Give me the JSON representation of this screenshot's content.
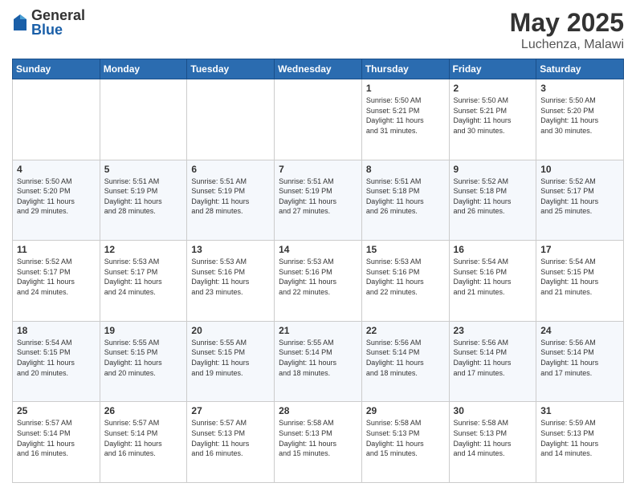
{
  "header": {
    "logo": {
      "general": "General",
      "blue": "Blue"
    },
    "title": "May 2025",
    "location": "Luchenza, Malawi"
  },
  "days_of_week": [
    "Sunday",
    "Monday",
    "Tuesday",
    "Wednesday",
    "Thursday",
    "Friday",
    "Saturday"
  ],
  "weeks": [
    [
      {
        "day": "",
        "info": ""
      },
      {
        "day": "",
        "info": ""
      },
      {
        "day": "",
        "info": ""
      },
      {
        "day": "",
        "info": ""
      },
      {
        "day": "1",
        "info": "Sunrise: 5:50 AM\nSunset: 5:21 PM\nDaylight: 11 hours\nand 31 minutes."
      },
      {
        "day": "2",
        "info": "Sunrise: 5:50 AM\nSunset: 5:21 PM\nDaylight: 11 hours\nand 30 minutes."
      },
      {
        "day": "3",
        "info": "Sunrise: 5:50 AM\nSunset: 5:20 PM\nDaylight: 11 hours\nand 30 minutes."
      }
    ],
    [
      {
        "day": "4",
        "info": "Sunrise: 5:50 AM\nSunset: 5:20 PM\nDaylight: 11 hours\nand 29 minutes."
      },
      {
        "day": "5",
        "info": "Sunrise: 5:51 AM\nSunset: 5:19 PM\nDaylight: 11 hours\nand 28 minutes."
      },
      {
        "day": "6",
        "info": "Sunrise: 5:51 AM\nSunset: 5:19 PM\nDaylight: 11 hours\nand 28 minutes."
      },
      {
        "day": "7",
        "info": "Sunrise: 5:51 AM\nSunset: 5:19 PM\nDaylight: 11 hours\nand 27 minutes."
      },
      {
        "day": "8",
        "info": "Sunrise: 5:51 AM\nSunset: 5:18 PM\nDaylight: 11 hours\nand 26 minutes."
      },
      {
        "day": "9",
        "info": "Sunrise: 5:52 AM\nSunset: 5:18 PM\nDaylight: 11 hours\nand 26 minutes."
      },
      {
        "day": "10",
        "info": "Sunrise: 5:52 AM\nSunset: 5:17 PM\nDaylight: 11 hours\nand 25 minutes."
      }
    ],
    [
      {
        "day": "11",
        "info": "Sunrise: 5:52 AM\nSunset: 5:17 PM\nDaylight: 11 hours\nand 24 minutes."
      },
      {
        "day": "12",
        "info": "Sunrise: 5:53 AM\nSunset: 5:17 PM\nDaylight: 11 hours\nand 24 minutes."
      },
      {
        "day": "13",
        "info": "Sunrise: 5:53 AM\nSunset: 5:16 PM\nDaylight: 11 hours\nand 23 minutes."
      },
      {
        "day": "14",
        "info": "Sunrise: 5:53 AM\nSunset: 5:16 PM\nDaylight: 11 hours\nand 22 minutes."
      },
      {
        "day": "15",
        "info": "Sunrise: 5:53 AM\nSunset: 5:16 PM\nDaylight: 11 hours\nand 22 minutes."
      },
      {
        "day": "16",
        "info": "Sunrise: 5:54 AM\nSunset: 5:16 PM\nDaylight: 11 hours\nand 21 minutes."
      },
      {
        "day": "17",
        "info": "Sunrise: 5:54 AM\nSunset: 5:15 PM\nDaylight: 11 hours\nand 21 minutes."
      }
    ],
    [
      {
        "day": "18",
        "info": "Sunrise: 5:54 AM\nSunset: 5:15 PM\nDaylight: 11 hours\nand 20 minutes."
      },
      {
        "day": "19",
        "info": "Sunrise: 5:55 AM\nSunset: 5:15 PM\nDaylight: 11 hours\nand 20 minutes."
      },
      {
        "day": "20",
        "info": "Sunrise: 5:55 AM\nSunset: 5:15 PM\nDaylight: 11 hours\nand 19 minutes."
      },
      {
        "day": "21",
        "info": "Sunrise: 5:55 AM\nSunset: 5:14 PM\nDaylight: 11 hours\nand 18 minutes."
      },
      {
        "day": "22",
        "info": "Sunrise: 5:56 AM\nSunset: 5:14 PM\nDaylight: 11 hours\nand 18 minutes."
      },
      {
        "day": "23",
        "info": "Sunrise: 5:56 AM\nSunset: 5:14 PM\nDaylight: 11 hours\nand 17 minutes."
      },
      {
        "day": "24",
        "info": "Sunrise: 5:56 AM\nSunset: 5:14 PM\nDaylight: 11 hours\nand 17 minutes."
      }
    ],
    [
      {
        "day": "25",
        "info": "Sunrise: 5:57 AM\nSunset: 5:14 PM\nDaylight: 11 hours\nand 16 minutes."
      },
      {
        "day": "26",
        "info": "Sunrise: 5:57 AM\nSunset: 5:14 PM\nDaylight: 11 hours\nand 16 minutes."
      },
      {
        "day": "27",
        "info": "Sunrise: 5:57 AM\nSunset: 5:13 PM\nDaylight: 11 hours\nand 16 minutes."
      },
      {
        "day": "28",
        "info": "Sunrise: 5:58 AM\nSunset: 5:13 PM\nDaylight: 11 hours\nand 15 minutes."
      },
      {
        "day": "29",
        "info": "Sunrise: 5:58 AM\nSunset: 5:13 PM\nDaylight: 11 hours\nand 15 minutes."
      },
      {
        "day": "30",
        "info": "Sunrise: 5:58 AM\nSunset: 5:13 PM\nDaylight: 11 hours\nand 14 minutes."
      },
      {
        "day": "31",
        "info": "Sunrise: 5:59 AM\nSunset: 5:13 PM\nDaylight: 11 hours\nand 14 minutes."
      }
    ]
  ]
}
